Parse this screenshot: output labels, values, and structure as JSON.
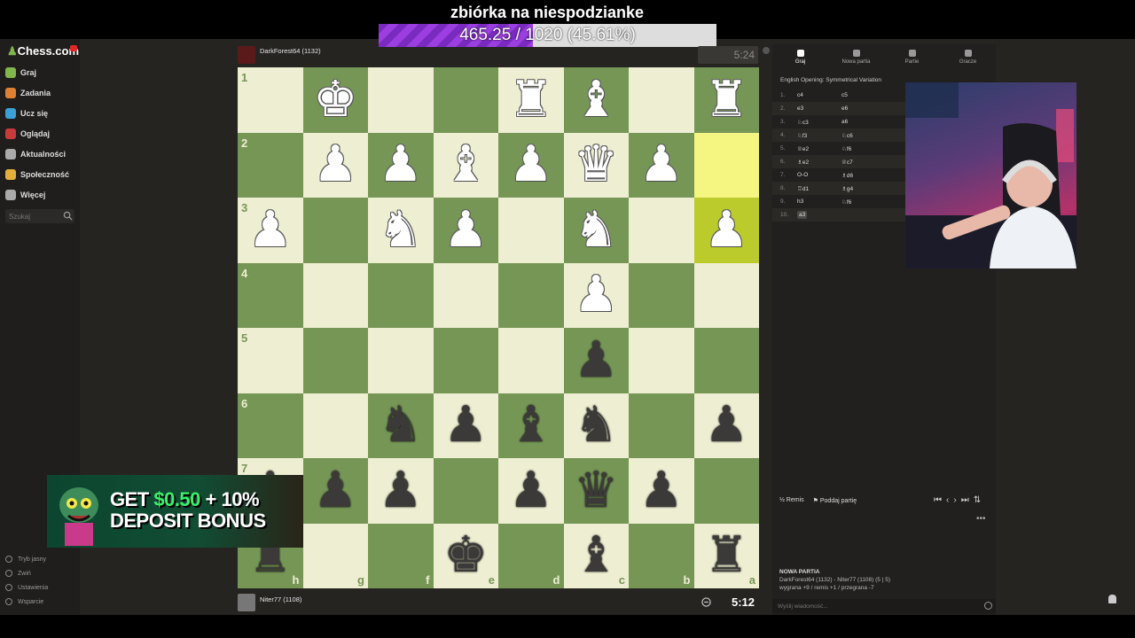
{
  "stream": {
    "donation_title": "zbiórka na niespodzianke",
    "progress_text": "465.25 / 1020 (45.61%)",
    "progress_fraction": 0.4561,
    "progress_color": "#8e35d6"
  },
  "sidebar": {
    "logo": "Chess.com",
    "items": [
      {
        "label": "Graj",
        "icon": "play-icon",
        "color": "#81b64c"
      },
      {
        "label": "Zadania",
        "icon": "puzzle-icon",
        "color": "#e08032"
      },
      {
        "label": "Ucz się",
        "icon": "learn-icon",
        "color": "#3aa0d8"
      },
      {
        "label": "Oglądaj",
        "icon": "watch-icon",
        "color": "#c93b3b"
      },
      {
        "label": "Aktualności",
        "icon": "news-icon",
        "color": "#aaaaaa"
      },
      {
        "label": "Społeczność",
        "icon": "community-icon",
        "color": "#e2b03a"
      },
      {
        "label": "Więcej",
        "icon": "more-icon",
        "color": "#aaaaaa"
      }
    ],
    "search_placeholder": "Szukaj",
    "bottom": [
      "Tryb jasny",
      "Zwiń",
      "Ustawienia",
      "Wsparcie"
    ]
  },
  "opponent": {
    "name": "DarkForest64 (1132)",
    "clock": "5:24"
  },
  "player": {
    "name": "Niter77 (1108)",
    "clock": "5:12"
  },
  "board": {
    "ranks": [
      "1",
      "2",
      "3",
      "4",
      "5",
      "6",
      "7",
      "8"
    ],
    "files": [
      "h",
      "g",
      "f",
      "e",
      "d",
      "c",
      "b",
      "a"
    ],
    "squares": [
      [
        "",
        "wK",
        "",
        "",
        "wR",
        "wB",
        "",
        "wR"
      ],
      [
        "",
        "wP",
        "wP",
        "wB",
        "wP",
        "wQ",
        "wP",
        ""
      ],
      [
        "wP",
        "",
        "wN",
        "wP",
        "",
        "wN",
        "",
        "wP"
      ],
      [
        "",
        "",
        "",
        "",
        "",
        "wP",
        "",
        ""
      ],
      [
        "",
        "",
        "",
        "",
        "",
        "bP",
        "",
        ""
      ],
      [
        "",
        "",
        "bN",
        "bP",
        "bB",
        "bN",
        "",
        "bP"
      ],
      [
        "bP",
        "bP",
        "bP",
        "",
        "bP",
        "bQ",
        "bP",
        ""
      ],
      [
        "bR",
        "",
        "",
        "bK",
        "",
        "bB",
        "",
        "bR"
      ]
    ],
    "highlighted": [
      "a2",
      "a3"
    ]
  },
  "panel": {
    "tabs": [
      "Graj",
      "Nowa partia",
      "Partie",
      "Gracze"
    ],
    "opening": "English Opening: Symmetrical Variation",
    "moves": [
      {
        "n": "1.",
        "w": "c4",
        "b": "c5"
      },
      {
        "n": "2.",
        "w": "e3",
        "b": "e6"
      },
      {
        "n": "3.",
        "w": "♘c3",
        "b": "a6"
      },
      {
        "n": "4.",
        "w": "♘f3",
        "b": "♘c6"
      },
      {
        "n": "5.",
        "w": "♕e2",
        "b": "♘f6"
      },
      {
        "n": "6.",
        "w": "♗e2",
        "b": "♕c7"
      },
      {
        "n": "7.",
        "w": "O-O",
        "b": "♗d6"
      },
      {
        "n": "8.",
        "w": "♖d1",
        "b": "♗g4"
      },
      {
        "n": "9.",
        "w": "h3",
        "b": "♘f6"
      },
      {
        "n": "10.",
        "w": "a3",
        "b": ""
      }
    ],
    "remis": "Remis",
    "resign": "Poddaj partię",
    "new_game_title": "NOWA PARTIA",
    "new_game_players": "DarkForest64 (1132) - Niter77 (1108) (5 | 5)",
    "new_game_stats": "wygrana +9 / remis +1 / przegrana -7",
    "chat_placeholder": "Wyślij wiadomość..."
  },
  "ad": {
    "line1_prefix": "GET ",
    "line1_amount": "$0.50",
    "line1_suffix": " + 10%",
    "line2": "DEPOSIT BONUS"
  },
  "colors": {
    "light_square": "#eeeed2",
    "dark_square": "#769656",
    "highlight": "#f5f682"
  }
}
